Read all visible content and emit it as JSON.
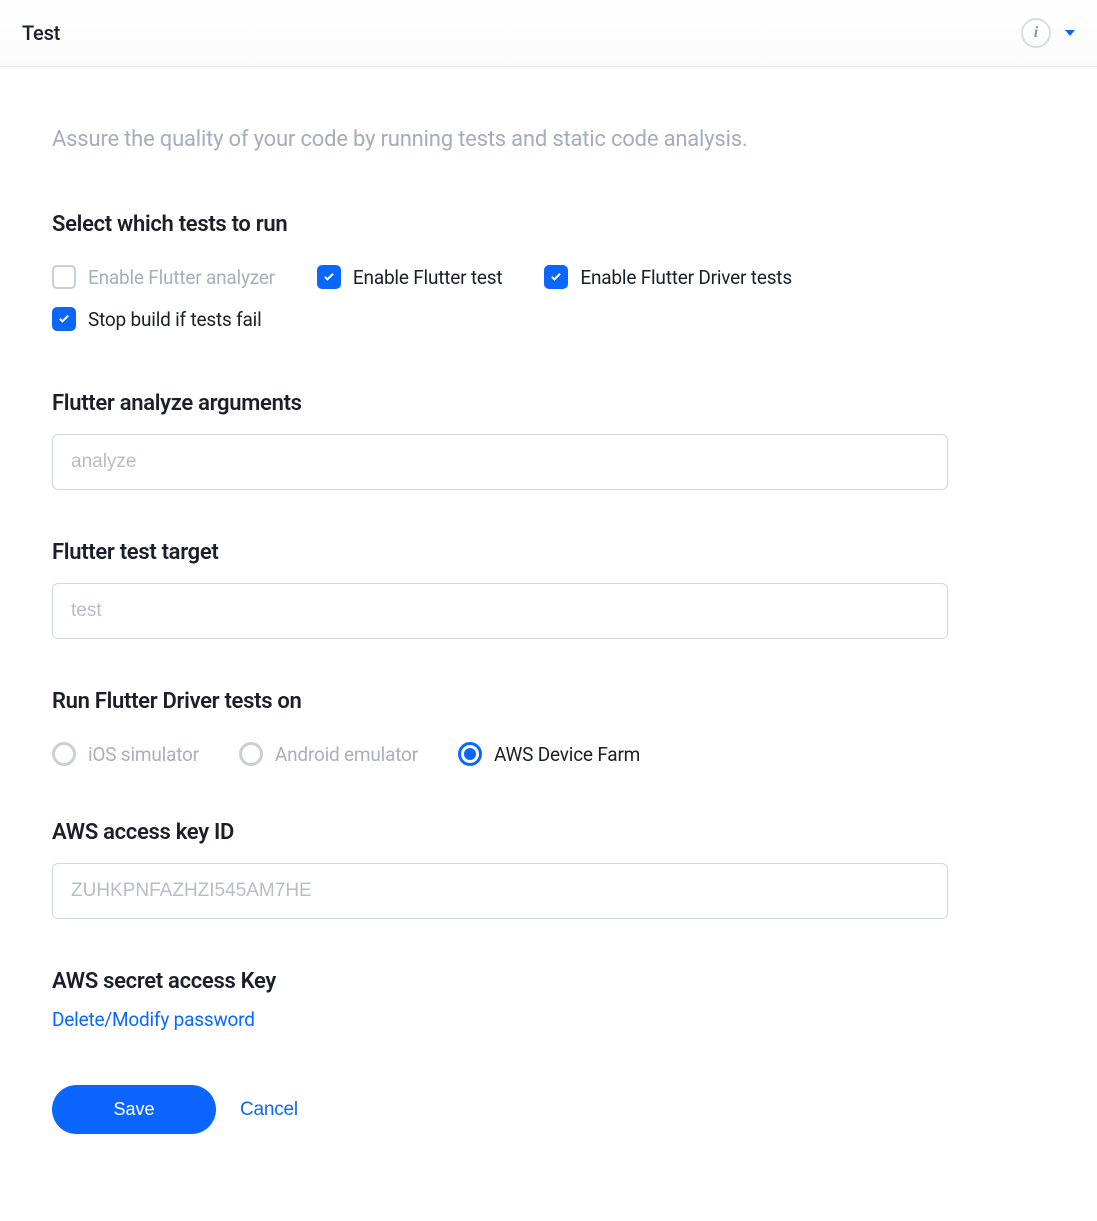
{
  "header": {
    "title": "Test"
  },
  "subtitle": "Assure the quality of your code by running tests and static code analysis.",
  "tests_section": {
    "heading": "Select which tests to run",
    "options": [
      {
        "label": "Enable Flutter analyzer",
        "checked": false
      },
      {
        "label": "Enable Flutter test",
        "checked": true
      },
      {
        "label": "Enable Flutter Driver tests",
        "checked": true
      },
      {
        "label": "Stop build if tests fail",
        "checked": true
      }
    ]
  },
  "analyze_args": {
    "label": "Flutter analyze arguments",
    "placeholder": "analyze",
    "value": ""
  },
  "test_target": {
    "label": "Flutter test target",
    "placeholder": "test",
    "value": ""
  },
  "driver_target": {
    "label": "Run Flutter Driver tests on",
    "options": [
      {
        "label": "iOS simulator",
        "selected": false
      },
      {
        "label": "Android emulator",
        "selected": false
      },
      {
        "label": "AWS Device Farm",
        "selected": true
      }
    ]
  },
  "aws_key_id": {
    "label": "AWS access key ID",
    "placeholder": "ZUHKPNFAZHZI545AM7HE",
    "value": ""
  },
  "aws_secret": {
    "label": "AWS secret access Key",
    "action_label": "Delete/Modify password"
  },
  "buttons": {
    "save": "Save",
    "cancel": "Cancel"
  }
}
